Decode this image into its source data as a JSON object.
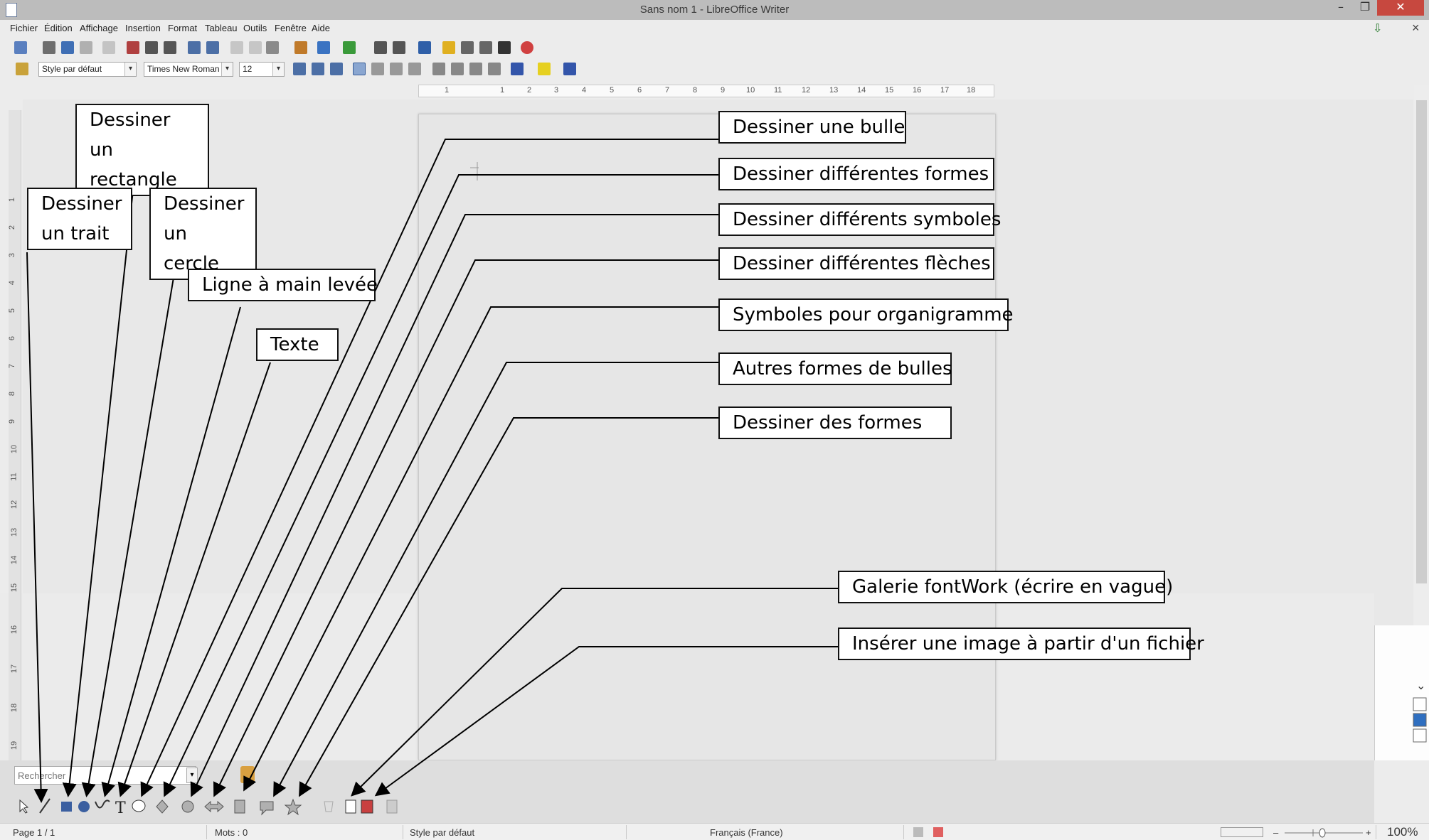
{
  "window": {
    "title": "Sans nom 1 - LibreOffice Writer",
    "minimize": "–",
    "maximize": "❐",
    "close": "✕"
  },
  "menu": [
    "Fichier",
    "Édition",
    "Affichage",
    "Insertion",
    "Format",
    "Tableau",
    "Outils",
    "Fenêtre",
    "Aide"
  ],
  "formatting": {
    "paragraph_style": "Style par défaut",
    "font_name": "Times New Roman",
    "font_size": "12"
  },
  "ruler": {
    "h_ticks": [
      "1",
      "1",
      "2",
      "3",
      "4",
      "5",
      "6",
      "7",
      "8",
      "9",
      "10",
      "11",
      "12",
      "13",
      "14",
      "15",
      "16",
      "17",
      "18"
    ],
    "v_ticks": [
      "1",
      "2",
      "3",
      "4",
      "5",
      "6",
      "7",
      "8",
      "9",
      "10",
      "11",
      "12",
      "13",
      "14",
      "15",
      "16",
      "17",
      "18",
      "19"
    ]
  },
  "search": {
    "placeholder": "Rechercher"
  },
  "callouts": {
    "rectangle": [
      "Dessiner un",
      "rectangle"
    ],
    "trait": [
      "Dessiner",
      "un trait"
    ],
    "cercle": [
      "Dessiner",
      "un cercle"
    ],
    "main_levee": "Ligne à main levée",
    "texte": "Texte",
    "bulle": "Dessiner une bulle",
    "formes_diff": "Dessiner différentes  formes",
    "symboles": "Dessiner différents symboles",
    "fleches": "Dessiner différentes flèches",
    "organigramme": "Symboles pour organigramme",
    "autres_bulles": "Autres formes de bulles",
    "des_formes": "Dessiner des formes",
    "fontwork": "Galerie fontWork (écrire en vague)",
    "image": "Insérer une image à partir d'un fichier"
  },
  "status": {
    "page": "Page 1 / 1",
    "words": "Mots : 0",
    "style": "Style par défaut",
    "language": "Français (France)",
    "zoom": "100%"
  },
  "colors": {
    "callout_border": "#111111",
    "close_button": "#c7483f",
    "accent_blue": "#2f5fa8"
  }
}
